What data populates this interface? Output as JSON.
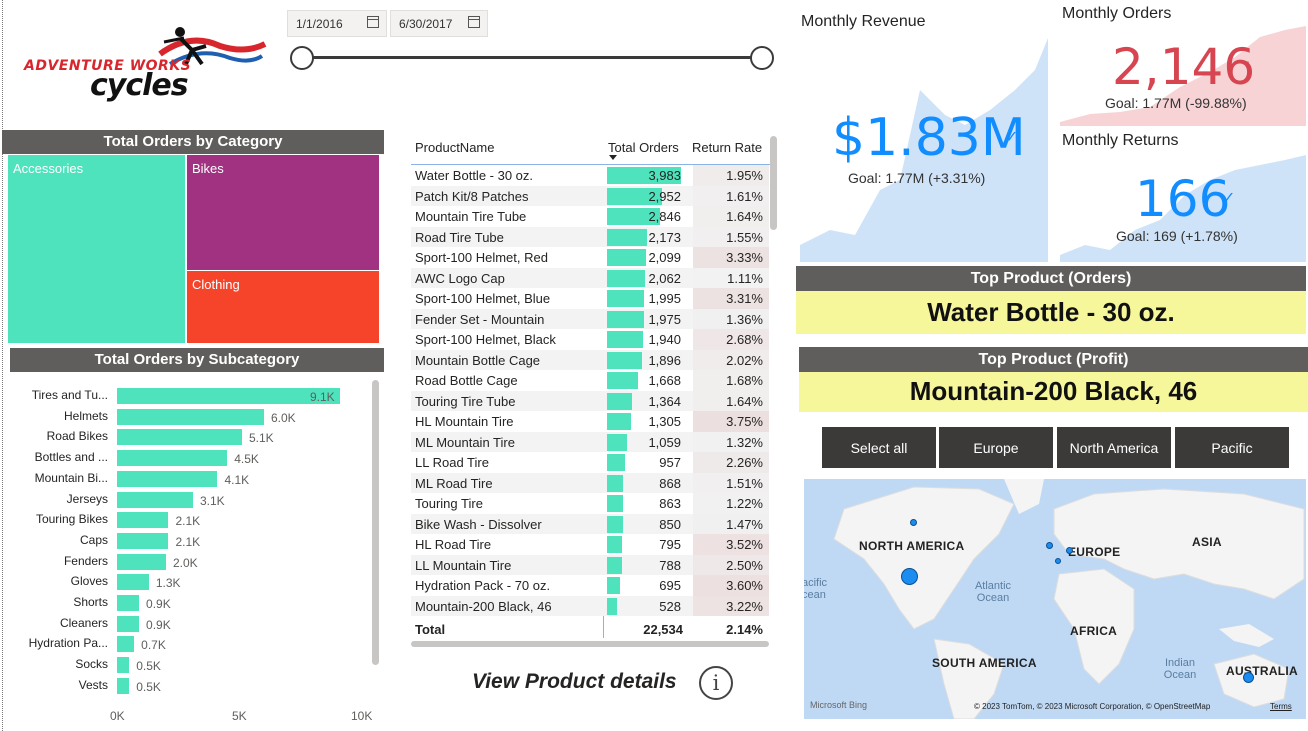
{
  "logo": {
    "line1": "ADVENTURE WORKS",
    "line2": "cycles"
  },
  "date_slicer": {
    "start": "1/1/2016",
    "end": "6/30/2017"
  },
  "treemap": {
    "title": "Total Orders by Category",
    "cells": [
      {
        "label": "Accessories",
        "color": "#4fe3bd"
      },
      {
        "label": "Bikes",
        "color": "#a03281"
      },
      {
        "label": "Clothing",
        "color": "#f5442a"
      }
    ]
  },
  "subcategory_chart": {
    "title": "Total Orders by Subcategory",
    "axis_ticks": [
      "0K",
      "5K",
      "10K"
    ],
    "rows": [
      {
        "label": "Tires and Tu...",
        "value": 9.1,
        "text": "9.1K"
      },
      {
        "label": "Helmets",
        "value": 6.0,
        "text": "6.0K"
      },
      {
        "label": "Road Bikes",
        "value": 5.1,
        "text": "5.1K"
      },
      {
        "label": "Bottles and ...",
        "value": 4.5,
        "text": "4.5K"
      },
      {
        "label": "Mountain Bi...",
        "value": 4.1,
        "text": "4.1K"
      },
      {
        "label": "Jerseys",
        "value": 3.1,
        "text": "3.1K"
      },
      {
        "label": "Touring Bikes",
        "value": 2.1,
        "text": "2.1K"
      },
      {
        "label": "Caps",
        "value": 2.1,
        "text": "2.1K"
      },
      {
        "label": "Fenders",
        "value": 2.0,
        "text": "2.0K"
      },
      {
        "label": "Gloves",
        "value": 1.3,
        "text": "1.3K"
      },
      {
        "label": "Shorts",
        "value": 0.9,
        "text": "0.9K"
      },
      {
        "label": "Cleaners",
        "value": 0.9,
        "text": "0.9K"
      },
      {
        "label": "Hydration Pa...",
        "value": 0.7,
        "text": "0.7K"
      },
      {
        "label": "Socks",
        "value": 0.5,
        "text": "0.5K"
      },
      {
        "label": "Vests",
        "value": 0.5,
        "text": "0.5K"
      }
    ]
  },
  "product_table": {
    "headers": {
      "name": "ProductName",
      "orders": "Total Orders",
      "rate": "Return Rate"
    },
    "rows": [
      {
        "name": "Water Bottle - 30 oz.",
        "orders": 3983,
        "orders_text": "3,983",
        "rate": "1.95%"
      },
      {
        "name": "Patch Kit/8 Patches",
        "orders": 2952,
        "orders_text": "2,952",
        "rate": "1.61%"
      },
      {
        "name": "Mountain Tire Tube",
        "orders": 2846,
        "orders_text": "2,846",
        "rate": "1.64%"
      },
      {
        "name": "Road Tire Tube",
        "orders": 2173,
        "orders_text": "2,173",
        "rate": "1.55%"
      },
      {
        "name": "Sport-100 Helmet, Red",
        "orders": 2099,
        "orders_text": "2,099",
        "rate": "3.33%"
      },
      {
        "name": "AWC Logo Cap",
        "orders": 2062,
        "orders_text": "2,062",
        "rate": "1.11%"
      },
      {
        "name": "Sport-100 Helmet, Blue",
        "orders": 1995,
        "orders_text": "1,995",
        "rate": "3.31%"
      },
      {
        "name": "Fender Set - Mountain",
        "orders": 1975,
        "orders_text": "1,975",
        "rate": "1.36%"
      },
      {
        "name": "Sport-100 Helmet, Black",
        "orders": 1940,
        "orders_text": "1,940",
        "rate": "2.68%"
      },
      {
        "name": "Mountain Bottle Cage",
        "orders": 1896,
        "orders_text": "1,896",
        "rate": "2.02%"
      },
      {
        "name": "Road Bottle Cage",
        "orders": 1668,
        "orders_text": "1,668",
        "rate": "1.68%"
      },
      {
        "name": "Touring Tire Tube",
        "orders": 1364,
        "orders_text": "1,364",
        "rate": "1.64%"
      },
      {
        "name": "HL Mountain Tire",
        "orders": 1305,
        "orders_text": "1,305",
        "rate": "3.75%"
      },
      {
        "name": "ML Mountain Tire",
        "orders": 1059,
        "orders_text": "1,059",
        "rate": "1.32%"
      },
      {
        "name": "LL Road Tire",
        "orders": 957,
        "orders_text": "957",
        "rate": "2.26%"
      },
      {
        "name": "ML Road Tire",
        "orders": 868,
        "orders_text": "868",
        "rate": "1.51%"
      },
      {
        "name": "Touring Tire",
        "orders": 863,
        "orders_text": "863",
        "rate": "1.22%"
      },
      {
        "name": "Bike Wash - Dissolver",
        "orders": 850,
        "orders_text": "850",
        "rate": "1.47%"
      },
      {
        "name": "HL Road Tire",
        "orders": 795,
        "orders_text": "795",
        "rate": "3.52%"
      },
      {
        "name": "LL Mountain Tire",
        "orders": 788,
        "orders_text": "788",
        "rate": "2.50%"
      },
      {
        "name": "Hydration Pack - 70 oz.",
        "orders": 695,
        "orders_text": "695",
        "rate": "3.60%"
      },
      {
        "name": "Mountain-200 Black, 46",
        "orders": 528,
        "orders_text": "528",
        "rate": "3.22%"
      }
    ],
    "total": {
      "label": "Total",
      "orders": "22,534",
      "rate": "2.14%"
    }
  },
  "view_details": {
    "label": "View Product details",
    "icon": "info-icon"
  },
  "kpi_revenue": {
    "title": "Monthly Revenue",
    "value": "$1.83M",
    "goal": "Goal: 1.77M (+3.31%)"
  },
  "kpi_orders": {
    "title": "Monthly Orders",
    "value": "2,146",
    "goal": "Goal: 1.77M (-99.88%)"
  },
  "kpi_returns": {
    "title": "Monthly Returns",
    "value": "166",
    "goal": "Goal: 169 (+1.78%)"
  },
  "top_product_orders": {
    "header": "Top Product (Orders)",
    "value": "Water Bottle - 30 oz."
  },
  "top_product_profit": {
    "header": "Top Product (Profit)",
    "value": "Mountain-200 Black, 46"
  },
  "region_buttons": [
    "Select all",
    "Europe",
    "North America",
    "Pacific"
  ],
  "map": {
    "labels": {
      "north_america": "NORTH AMERICA",
      "europe": "EUROPE",
      "asia": "ASIA",
      "africa": "AFRICA",
      "south_america": "SOUTH AMERICA",
      "australia": "AUSTRALIA"
    },
    "oceans": {
      "atlantic": "Atlantic\nOcean",
      "pacific": "acific\ncean",
      "indian": "Indian\nOcean"
    },
    "attribution": "© 2023 TomTom, © 2023 Microsoft Corporation, © OpenStreetMap",
    "terms": "Terms",
    "bing": "Microsoft Bing"
  },
  "colors": {
    "accent_green": "#4fe3bd",
    "kpi_blue": "#118dff",
    "kpi_red": "#d64550",
    "header_gray": "#605e5c",
    "highlight_yellow": "#f6f79a"
  }
}
